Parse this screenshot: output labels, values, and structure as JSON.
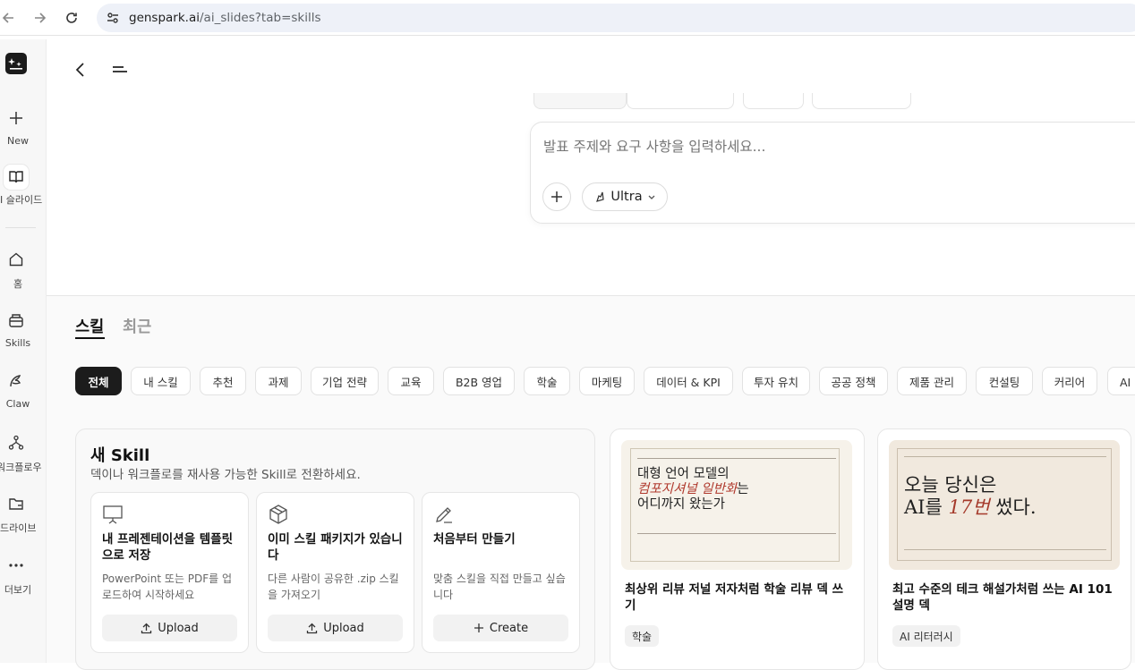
{
  "browser": {
    "url_host": "genspark.ai",
    "url_path": "/ai_slides?tab=skills"
  },
  "sidebar": {
    "items": [
      {
        "label": "New",
        "icon": "plus-icon"
      },
      {
        "label": "I 슬라이드",
        "icon": "book-icon",
        "active": true
      },
      {
        "label": "홈",
        "icon": "home-icon"
      },
      {
        "label": "Skills",
        "icon": "skills-icon"
      },
      {
        "label": "Claw",
        "icon": "claw-icon"
      },
      {
        "label": "워크플로우",
        "icon": "workflow-icon"
      },
      {
        "label": "드라이브",
        "icon": "folder-icon"
      },
      {
        "label": "더보기",
        "icon": "more-icon"
      }
    ]
  },
  "composer": {
    "placeholder": "발표 주제와 요구 사항을 입력하세요...",
    "model_label": "Ultra"
  },
  "tabs": [
    {
      "label": "스킬",
      "active": true
    },
    {
      "label": "최근",
      "active": false
    }
  ],
  "filters": [
    "전체",
    "내 스킬",
    "추천",
    "과제",
    "기업 전략",
    "교육",
    "B2B 영업",
    "학술",
    "마케팅",
    "데이터 & KPI",
    "투자 유치",
    "공공 정책",
    "제품 관리",
    "컨설팅",
    "커리어",
    "AI 리터러시"
  ],
  "new_skill": {
    "title": "새 Skill",
    "subtitle": "덱이나 워크플로를 재사용 가능한 Skill로 전환하세요.",
    "options": [
      {
        "title": "내 프레젠테이션을 템플릿으로 저장",
        "desc": "PowerPoint 또는 PDF를 업로드하여 시작하세요",
        "button": "Upload",
        "icon": "presentation-icon",
        "button_icon": "upload-icon"
      },
      {
        "title": "이미 스킬 패키지가 있습니다",
        "desc": "다른 사람이 공유한 .zip 스킬을 가져오기",
        "button": "Upload",
        "icon": "package-icon",
        "button_icon": "upload-icon"
      },
      {
        "title": "처음부터 만들기",
        "desc": "맞춤 스킬을 직접 만들고 싶습니다",
        "button": "Create",
        "icon": "pencil-icon",
        "button_icon": "plus-icon"
      }
    ]
  },
  "decks": [
    {
      "title": "최상위 리뷰 저널 저자처럼 학술 리뷰 덱 쓰기",
      "tag": "학술",
      "thumb_lines": [
        "대형 언어 모델의",
        "컴포지셔널 일반화",
        "는",
        "어디까지 왔는가"
      ]
    },
    {
      "title": "최고 수준의 테크 해설가처럼 쓰는 AI 101 설명 덱",
      "tag": "AI 리터러시",
      "thumb_lines": [
        "오늘 당신은",
        "AI를 ",
        "17번",
        " 썼다."
      ]
    }
  ]
}
